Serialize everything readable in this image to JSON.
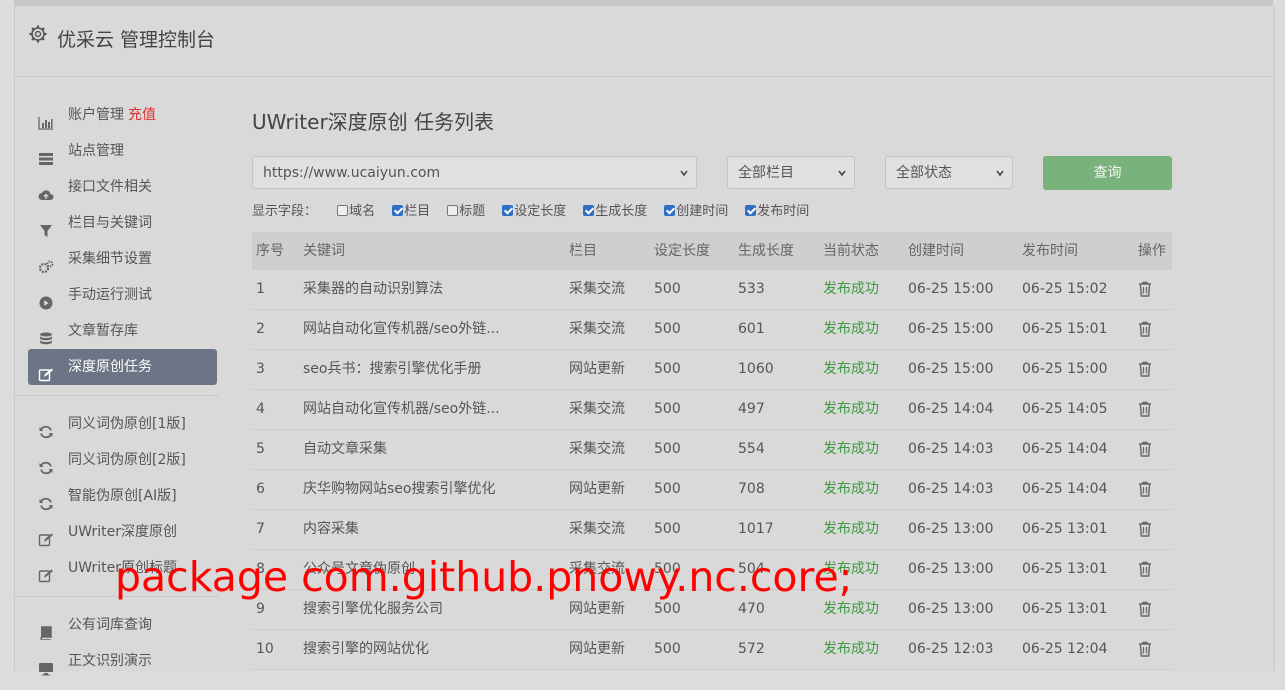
{
  "header": {
    "title": "优采云 管理控制台"
  },
  "sidebar": {
    "group1": [
      {
        "label": "账户管理",
        "extra": "充值",
        "icon": "bar-chart-icon"
      },
      {
        "label": "站点管理",
        "icon": "server-icon"
      },
      {
        "label": "接口文件相关",
        "icon": "cloud-upload-icon"
      },
      {
        "label": "栏目与关键词",
        "icon": "filter-icon"
      },
      {
        "label": "采集细节设置",
        "icon": "gears-icon"
      },
      {
        "label": "手动运行测试",
        "icon": "play-icon"
      },
      {
        "label": "文章暂存库",
        "icon": "database-icon"
      },
      {
        "label": "深度原创任务",
        "icon": "edit-icon",
        "active": true
      }
    ],
    "group2": [
      {
        "label": "同义词伪原创[1版]",
        "icon": "refresh-icon"
      },
      {
        "label": "同义词伪原创[2版]",
        "icon": "refresh-icon"
      },
      {
        "label": "智能伪原创[AI版]",
        "icon": "refresh-icon"
      },
      {
        "label": "UWriter深度原创",
        "icon": "edit-icon"
      },
      {
        "label": "UWriter原创标题",
        "icon": "edit-icon"
      }
    ],
    "group3": [
      {
        "label": "公有词库查询",
        "icon": "book-icon"
      },
      {
        "label": "正文识别演示",
        "icon": "monitor-icon"
      }
    ]
  },
  "main": {
    "title": "UWriter深度原创 任务列表",
    "site_select": "https://www.ucaiyun.com",
    "column_select": "全部栏目",
    "status_select": "全部状态",
    "query_button": "查询",
    "fields_label": "显示字段：",
    "fields": [
      {
        "label": "域名",
        "checked": false
      },
      {
        "label": "栏目",
        "checked": true
      },
      {
        "label": "标题",
        "checked": false
      },
      {
        "label": "设定长度",
        "checked": true
      },
      {
        "label": "生成长度",
        "checked": true
      },
      {
        "label": "创建时间",
        "checked": true
      },
      {
        "label": "发布时间",
        "checked": true
      }
    ],
    "columns": [
      "序号",
      "关键词",
      "栏目",
      "设定长度",
      "生成长度",
      "当前状态",
      "创建时间",
      "发布时间",
      "操作"
    ],
    "rows": [
      [
        "1",
        "采集器的自动识别算法",
        "采集交流",
        "500",
        "533",
        "发布成功",
        "06-25 15:00",
        "06-25 15:02"
      ],
      [
        "2",
        "网站自动化宣传机器/seo外链...",
        "采集交流",
        "500",
        "601",
        "发布成功",
        "06-25 15:00",
        "06-25 15:01"
      ],
      [
        "3",
        "seo兵书：搜索引擎优化手册",
        "网站更新",
        "500",
        "1060",
        "发布成功",
        "06-25 15:00",
        "06-25 15:00"
      ],
      [
        "4",
        "网站自动化宣传机器/seo外链...",
        "采集交流",
        "500",
        "497",
        "发布成功",
        "06-25 14:04",
        "06-25 14:05"
      ],
      [
        "5",
        "自动文章采集",
        "采集交流",
        "500",
        "554",
        "发布成功",
        "06-25 14:03",
        "06-25 14:04"
      ],
      [
        "6",
        "庆华购物网站seo搜索引擎优化",
        "网站更新",
        "500",
        "708",
        "发布成功",
        "06-25 14:03",
        "06-25 14:04"
      ],
      [
        "7",
        "内容采集",
        "采集交流",
        "500",
        "1017",
        "发布成功",
        "06-25 13:00",
        "06-25 13:01"
      ],
      [
        "8",
        "公众号文章伪原创",
        "采集交流",
        "500",
        "504",
        "发布成功",
        "06-25 13:00",
        "06-25 13:01"
      ],
      [
        "9",
        "搜索引擎优化服务公司",
        "网站更新",
        "500",
        "470",
        "发布成功",
        "06-25 13:00",
        "06-25 13:01"
      ],
      [
        "10",
        "搜索引擎的网站优化",
        "网站更新",
        "500",
        "572",
        "发布成功",
        "06-25 12:03",
        "06-25 12:04"
      ]
    ]
  },
  "overlay": {
    "watermark": "package com.github.pnowy.nc.core;"
  }
}
